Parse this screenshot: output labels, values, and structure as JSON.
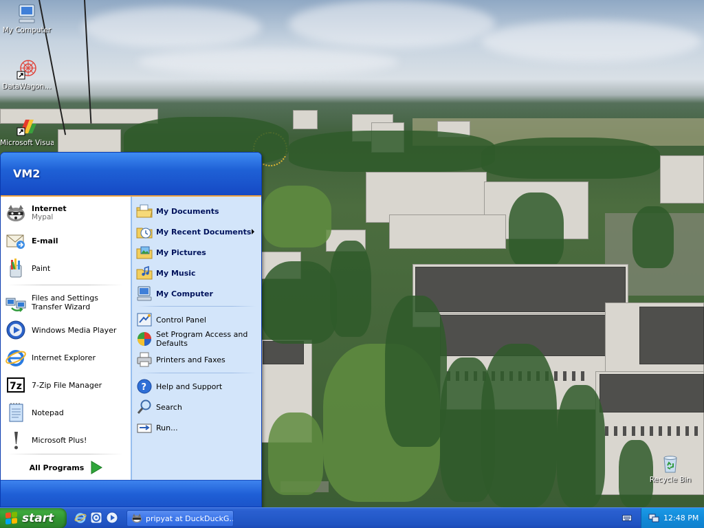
{
  "desktop": {
    "icons": [
      {
        "label": "My Computer",
        "icon": "my-computer-icon"
      },
      {
        "label": "DataWagon…",
        "icon": "datawagon-shortcut-icon"
      },
      {
        "label": "Microsoft Visual",
        "icon": "visual-studio-icon"
      },
      {
        "label": "Recycle Bin",
        "icon": "recycle-bin-icon"
      }
    ]
  },
  "start_menu": {
    "user": "VM2",
    "pinned": [
      {
        "label": "Internet",
        "sub": "Mypal",
        "icon": "mypal-browser-icon"
      },
      {
        "label": "E-mail",
        "icon": "email-icon"
      }
    ],
    "recent_programs": [
      {
        "label": "Paint",
        "icon": "paint-icon"
      },
      {
        "label": "Files and Settings Transfer Wizard",
        "icon": "transfer-wizard-icon"
      },
      {
        "label": "Windows Media Player",
        "icon": "media-player-icon"
      },
      {
        "label": "Internet Explorer",
        "icon": "internet-explorer-icon"
      },
      {
        "label": "7-Zip File Manager",
        "icon": "7zip-icon"
      },
      {
        "label": "Notepad",
        "icon": "notepad-icon"
      },
      {
        "label": "Microsoft Plus!",
        "icon": "microsoft-plus-icon"
      }
    ],
    "all_programs": "All Programs",
    "places": [
      {
        "label": "My Documents",
        "icon": "my-documents-icon"
      },
      {
        "label": "My Recent Documents",
        "icon": "recent-documents-icon"
      },
      {
        "label": "My Pictures",
        "icon": "my-pictures-icon"
      },
      {
        "label": "My Music",
        "icon": "my-music-icon"
      },
      {
        "label": "My Computer",
        "icon": "my-computer-icon"
      }
    ],
    "settings": [
      {
        "label": "Control Panel",
        "icon": "control-panel-icon"
      },
      {
        "label": "Set Program Access and Defaults",
        "icon": "program-access-icon"
      },
      {
        "label": "Printers and Faxes",
        "icon": "printer-icon"
      }
    ],
    "help": [
      {
        "label": "Help and Support",
        "icon": "help-icon"
      },
      {
        "label": "Search",
        "icon": "search-icon"
      },
      {
        "label": "Run...",
        "icon": "run-icon"
      }
    ]
  },
  "taskbar": {
    "start_label": "start",
    "quick_launch": [
      "internet-explorer-icon",
      "mypal-browser-icon",
      "media-player-icon"
    ],
    "task": {
      "label": "pripyat at DuckDuckG…",
      "icon": "mypal-browser-icon"
    },
    "clock": "12:48 PM"
  }
}
